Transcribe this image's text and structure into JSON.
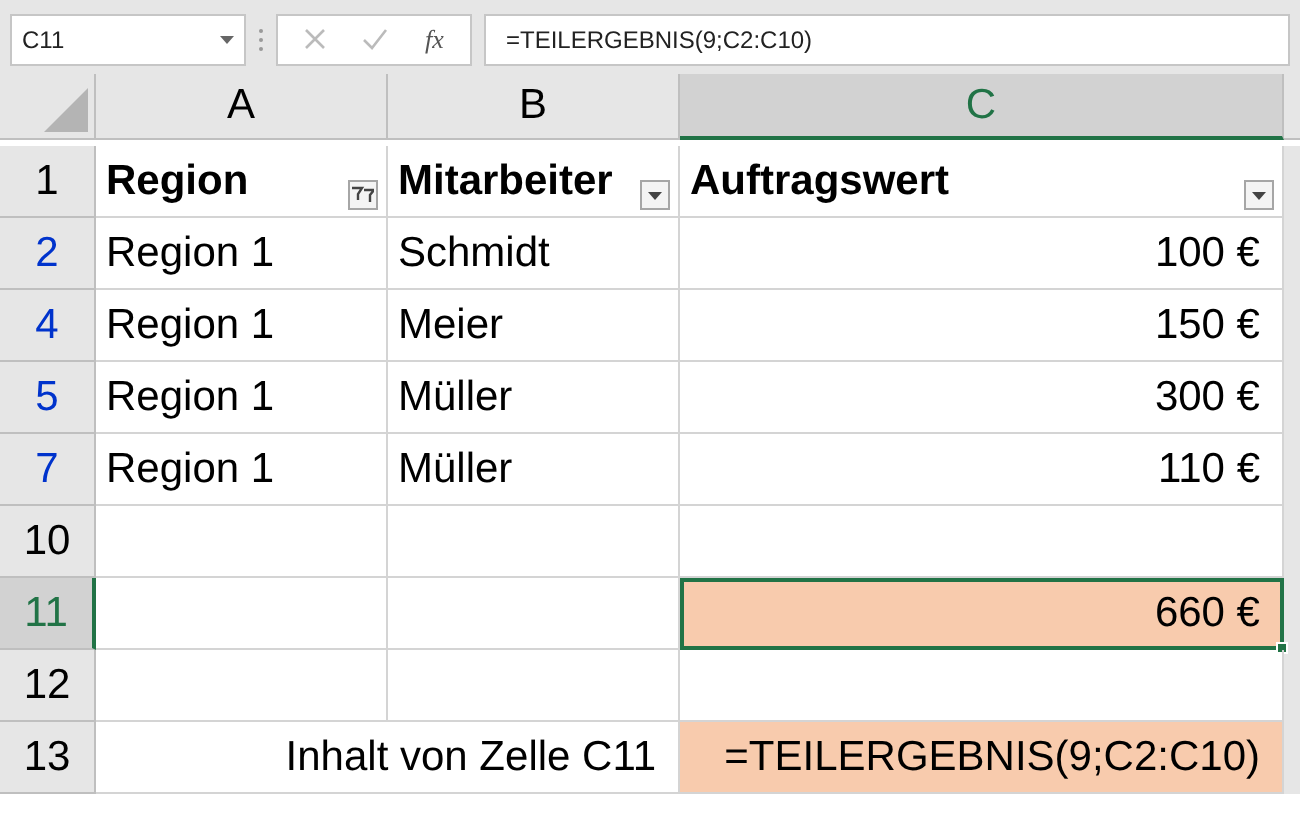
{
  "name_box": "C11",
  "function_label": "fx",
  "formula": "=TEILERGEBNIS(9;C2:C10)",
  "columns": [
    {
      "label": "A",
      "selected": false
    },
    {
      "label": "B",
      "selected": false
    },
    {
      "label": "C",
      "selected": true
    }
  ],
  "rows": [
    {
      "number": "1",
      "kind": "header",
      "filtered": false,
      "selected": false,
      "cells": [
        {
          "text": "Region",
          "filter_button": true,
          "filter_applied": true
        },
        {
          "text": "Mitarbeiter",
          "filter_button": true,
          "filter_applied": false
        },
        {
          "text": "Auftragswert",
          "filter_button": true,
          "filter_applied": false
        }
      ]
    },
    {
      "number": "2",
      "kind": "data",
      "filtered": true,
      "selected": false,
      "cells": [
        {
          "text": "Region 1"
        },
        {
          "text": "Schmidt"
        },
        {
          "text": "100 €",
          "right_aligned": true
        }
      ]
    },
    {
      "number": "4",
      "kind": "data",
      "filtered": true,
      "selected": false,
      "cells": [
        {
          "text": "Region 1"
        },
        {
          "text": "Meier"
        },
        {
          "text": "150 €",
          "right_aligned": true
        }
      ]
    },
    {
      "number": "5",
      "kind": "data",
      "filtered": true,
      "selected": false,
      "cells": [
        {
          "text": "Region 1"
        },
        {
          "text": "Müller"
        },
        {
          "text": "300 €",
          "right_aligned": true
        }
      ]
    },
    {
      "number": "7",
      "kind": "data",
      "filtered": true,
      "selected": false,
      "cells": [
        {
          "text": "Region 1"
        },
        {
          "text": "Müller"
        },
        {
          "text": "110 €",
          "right_aligned": true
        }
      ]
    },
    {
      "number": "10",
      "kind": "data",
      "filtered": false,
      "selected": false,
      "cells": [
        {},
        {},
        {}
      ]
    },
    {
      "number": "11",
      "kind": "data",
      "filtered": false,
      "selected": true,
      "cells": [
        {},
        {},
        {
          "text": "660 €",
          "right_aligned": true,
          "highlighted": true,
          "active": true
        }
      ]
    },
    {
      "number": "12",
      "kind": "data",
      "filtered": false,
      "selected": false,
      "cells": [
        {},
        {},
        {}
      ]
    },
    {
      "number": "13",
      "kind": "data",
      "filtered": false,
      "selected": false,
      "cells": [
        {
          "text": "Inhalt von Zelle C11",
          "right_aligned": true,
          "spans_next_column": true
        },
        {
          "text": "=TEILERGEBNIS(9;C2:C10)",
          "right_aligned": true,
          "highlighted": true
        }
      ]
    }
  ]
}
